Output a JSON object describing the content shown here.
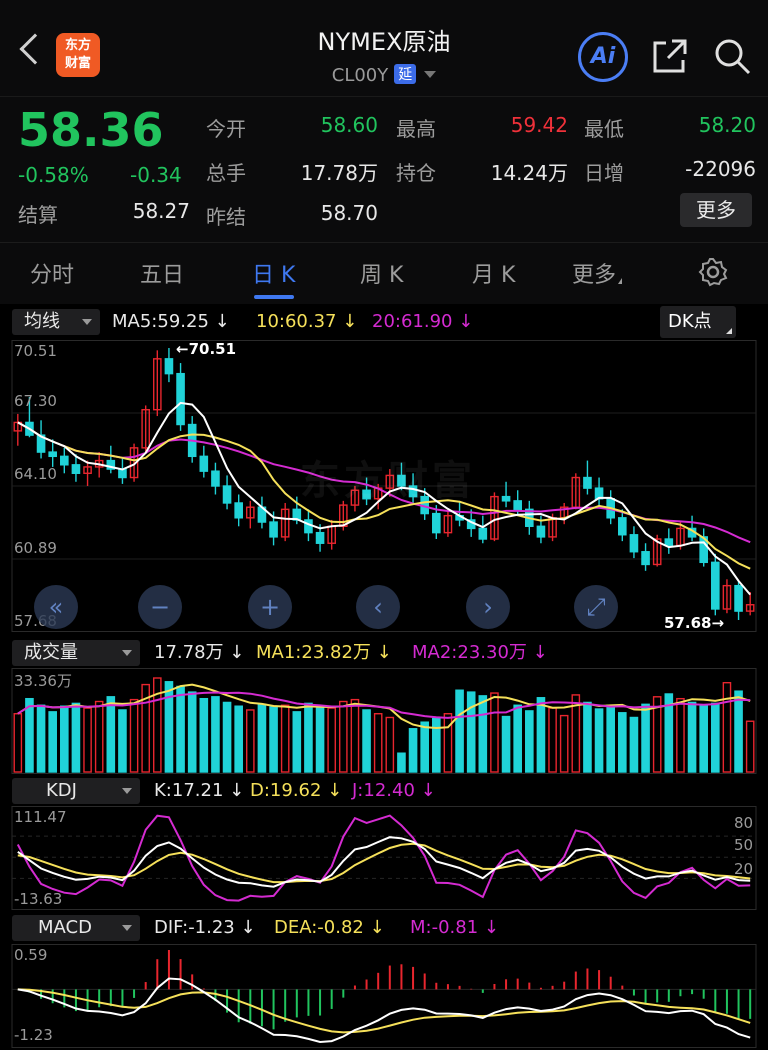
{
  "header": {
    "back_icon": "back-chevron-icon",
    "logo_text_1": "东方",
    "logo_text_2": "财富",
    "title": "NYMEX原油",
    "code": "CL00Y",
    "delay_badge": "延",
    "ai_label": "Ai"
  },
  "quote": {
    "price": "58.36",
    "change_pct": "-0.58%",
    "change": "-0.34",
    "settle_label": "结算",
    "settle": "58.27",
    "open_label": "今开",
    "open": "58.60",
    "high_label": "最高",
    "high": "59.42",
    "low_label": "最低",
    "low": "58.20",
    "volume_label": "总手",
    "volume": "17.78万",
    "oi_label": "持仓",
    "oi": "14.24万",
    "daily_inc_label": "日增",
    "daily_inc": "-22096",
    "prev_settle_label": "昨结",
    "prev_settle": "58.70",
    "more_button": "更多",
    "colors": {
      "up": "#f0313a",
      "down": "#21c45e"
    }
  },
  "tabs": [
    {
      "label": "分时"
    },
    {
      "label": "五日"
    },
    {
      "label": "日 K"
    },
    {
      "label": "周 K"
    },
    {
      "label": "月 K"
    },
    {
      "label": "更多"
    }
  ],
  "active_tab": "日 K",
  "kline": {
    "selector": "均线",
    "ma5": "MA5:59.25 ↓",
    "ma10": "10:60.37 ↓",
    "ma20": "20:61.90 ↓",
    "dk_button": "DK点",
    "y_labels": [
      "70.51",
      "67.30",
      "64.10",
      "60.89",
      "57.68"
    ],
    "max_marker": "70.51",
    "min_marker": "57.68→",
    "watermark": "东方财富",
    "colors": {
      "ma5": "#ffffff",
      "ma10": "#f5e05a",
      "ma20": "#d42bd1",
      "up": "#e8262e",
      "down": "#20d3d8"
    }
  },
  "volume": {
    "selector": "成交量",
    "value": "17.78万 ↓",
    "ma1": "MA1:23.82万 ↓",
    "ma2": "MA2:23.30万 ↓",
    "y_label": "33.36万"
  },
  "kdj": {
    "selector": "KDJ",
    "k": "K:17.21 ↓",
    "d": "D:19.62 ↓",
    "j": "J:12.40 ↓",
    "y_top": "111.47",
    "y_bottom": "-13.63",
    "levels": [
      "80",
      "50",
      "20"
    ]
  },
  "macd": {
    "selector": "MACD",
    "dif": "DIF:-1.23 ↓",
    "dea": "DEA:-0.82 ↓",
    "m": "M:-0.81 ↓",
    "y_top": "0.59",
    "y_bottom": "-1.23"
  },
  "chart_data": {
    "type": "candlestick",
    "price_range": [
      57.68,
      70.51
    ],
    "candles": [
      [
        66.6,
        67.4,
        65.9,
        67.0
      ],
      [
        67.0,
        68.2,
        66.3,
        66.4
      ],
      [
        66.4,
        67.1,
        65.3,
        65.6
      ],
      [
        65.6,
        66.2,
        64.9,
        65.4
      ],
      [
        65.4,
        65.8,
        64.6,
        65.0
      ],
      [
        65.0,
        65.5,
        64.2,
        64.6
      ],
      [
        64.6,
        65.2,
        64.0,
        64.9
      ],
      [
        64.9,
        65.6,
        64.4,
        65.2
      ],
      [
        65.2,
        65.9,
        64.6,
        64.8
      ],
      [
        64.8,
        65.3,
        64.1,
        64.4
      ],
      [
        64.4,
        66.0,
        64.2,
        65.8
      ],
      [
        65.8,
        67.8,
        65.6,
        67.6
      ],
      [
        67.6,
        70.4,
        67.3,
        70.0
      ],
      [
        70.0,
        70.51,
        68.9,
        69.3
      ],
      [
        69.3,
        69.8,
        66.6,
        66.9
      ],
      [
        66.9,
        67.3,
        65.1,
        65.4
      ],
      [
        65.4,
        65.9,
        64.4,
        64.7
      ],
      [
        64.7,
        65.1,
        63.6,
        64.0
      ],
      [
        64.0,
        64.5,
        62.9,
        63.2
      ],
      [
        63.2,
        63.6,
        62.1,
        62.5
      ],
      [
        62.5,
        63.3,
        62.0,
        63.0
      ],
      [
        63.0,
        63.5,
        62.0,
        62.3
      ],
      [
        62.3,
        62.8,
        61.2,
        61.6
      ],
      [
        61.6,
        63.2,
        61.4,
        62.9
      ],
      [
        62.9,
        63.5,
        62.2,
        62.4
      ],
      [
        62.4,
        62.9,
        61.4,
        61.8
      ],
      [
        61.8,
        62.2,
        60.9,
        61.3
      ],
      [
        61.3,
        62.4,
        61.0,
        62.1
      ],
      [
        62.1,
        63.3,
        61.9,
        63.1
      ],
      [
        63.1,
        64.0,
        62.8,
        63.8
      ],
      [
        63.8,
        64.4,
        63.1,
        63.4
      ],
      [
        63.4,
        64.1,
        62.9,
        63.9
      ],
      [
        63.9,
        64.8,
        63.5,
        64.5
      ],
      [
        64.5,
        65.1,
        63.8,
        64.0
      ],
      [
        64.0,
        64.6,
        63.2,
        63.5
      ],
      [
        63.5,
        63.9,
        62.4,
        62.7
      ],
      [
        62.7,
        63.1,
        61.5,
        61.8
      ],
      [
        61.8,
        62.8,
        61.6,
        62.6
      ],
      [
        62.6,
        63.3,
        62.1,
        62.4
      ],
      [
        62.4,
        62.9,
        61.6,
        62.0
      ],
      [
        62.0,
        62.6,
        61.3,
        61.5
      ],
      [
        61.5,
        63.7,
        61.4,
        63.5
      ],
      [
        63.5,
        64.2,
        63.0,
        63.3
      ],
      [
        63.3,
        63.8,
        62.6,
        62.9
      ],
      [
        62.9,
        63.3,
        61.7,
        62.1
      ],
      [
        62.1,
        62.6,
        61.3,
        61.6
      ],
      [
        61.6,
        62.7,
        61.4,
        62.5
      ],
      [
        62.5,
        63.2,
        62.2,
        63.0
      ],
      [
        63.0,
        64.6,
        62.9,
        64.4
      ],
      [
        64.4,
        65.2,
        63.6,
        63.9
      ],
      [
        63.9,
        64.4,
        63.0,
        63.4
      ],
      [
        63.4,
        63.8,
        62.2,
        62.5
      ],
      [
        62.5,
        62.9,
        61.4,
        61.7
      ],
      [
        61.7,
        62.1,
        60.6,
        60.9
      ],
      [
        60.9,
        61.3,
        60.0,
        60.3
      ],
      [
        60.3,
        61.7,
        60.2,
        61.5
      ],
      [
        61.5,
        62.0,
        60.8,
        61.2
      ],
      [
        61.2,
        62.3,
        61.0,
        62.0
      ],
      [
        62.0,
        62.6,
        61.4,
        61.6
      ],
      [
        61.6,
        62.0,
        60.2,
        60.4
      ],
      [
        60.4,
        60.8,
        57.9,
        58.2
      ],
      [
        58.2,
        59.6,
        58.0,
        59.3
      ],
      [
        59.3,
        59.5,
        57.68,
        58.1
      ],
      [
        58.1,
        59.0,
        57.9,
        58.4
      ]
    ],
    "volume_ratio": [
      0.62,
      0.78,
      0.71,
      0.64,
      0.7,
      0.73,
      0.68,
      0.75,
      0.8,
      0.66,
      0.77,
      0.93,
      1.0,
      0.96,
      0.91,
      0.85,
      0.78,
      0.8,
      0.74,
      0.7,
      0.66,
      0.72,
      0.69,
      0.71,
      0.64,
      0.73,
      0.7,
      0.68,
      0.75,
      0.77,
      0.66,
      0.62,
      0.58,
      0.2,
      0.46,
      0.53,
      0.57,
      0.62,
      0.87,
      0.85,
      0.81,
      0.84,
      0.59,
      0.71,
      0.65,
      0.79,
      0.68,
      0.6,
      0.82,
      0.74,
      0.67,
      0.71,
      0.63,
      0.58,
      0.72,
      0.8,
      0.83,
      0.78,
      0.74,
      0.7,
      0.73,
      0.95,
      0.86,
      0.54
    ]
  }
}
